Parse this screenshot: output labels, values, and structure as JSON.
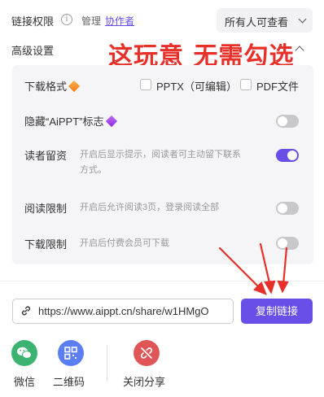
{
  "header": {
    "permission_label": "链接权限",
    "info_icon": "info-icon",
    "manage_label": "管理",
    "collaborators_link": "协作者",
    "permission_select_value": "所有人可查看"
  },
  "advanced": {
    "label": "高级设置",
    "annotation": "这玩意 无需勾选"
  },
  "settings": {
    "download_format": {
      "label": "下载格式",
      "options": [
        {
          "label": "PPTX（可编辑）",
          "checked": false
        },
        {
          "label": "PDF文件",
          "checked": false
        }
      ]
    },
    "hide_logo": {
      "label": "隐藏“AiPPT”标志",
      "enabled": false
    },
    "reader_message": {
      "label": "读者留资",
      "description_line1": "开启后显示提示，阅读者可主动留下联系",
      "description_line2": "方式。",
      "enabled": true
    },
    "read_limit": {
      "label": "阅读限制",
      "description": "开启后允许阅读3页，登录阅读全部",
      "enabled": false
    },
    "download_limit": {
      "label": "下载限制",
      "description": "开启后付费会员可下载",
      "enabled": false
    }
  },
  "share": {
    "url": "https://www.aippt.cn/share/w1HMgO",
    "copy_button": "复制链接",
    "targets": [
      {
        "label": "微信",
        "icon": "wechat-icon",
        "color": "#3cb371"
      },
      {
        "label": "二维码",
        "icon": "qr-code-icon",
        "color": "#5b7ef5"
      },
      {
        "label": "关闭分享",
        "icon": "unlink-icon",
        "color": "#e05555"
      }
    ]
  },
  "colors": {
    "accent": "#6a4ee8",
    "annotation": "#e8302a"
  }
}
